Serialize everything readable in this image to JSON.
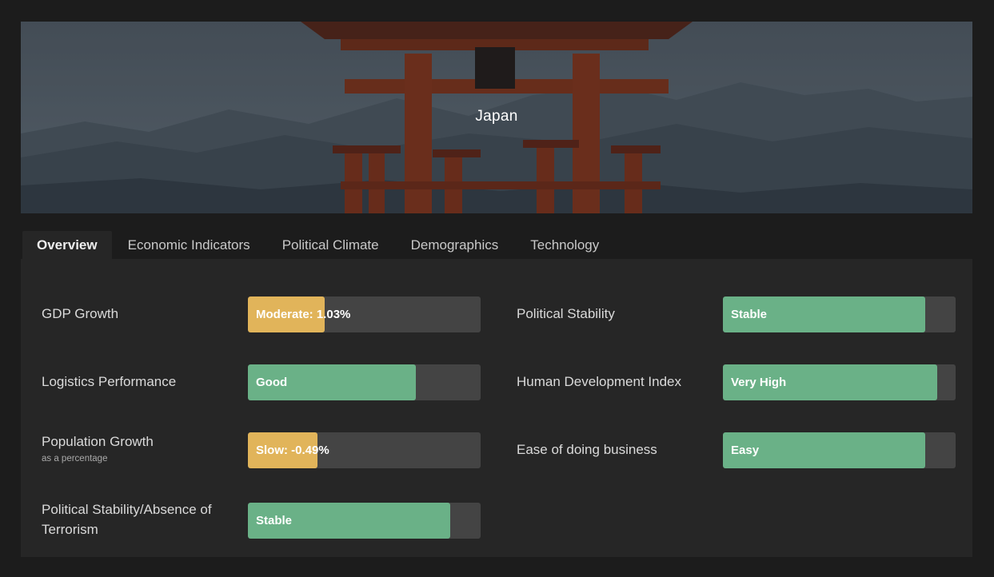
{
  "hero": {
    "title": "Japan",
    "image_description_icon": "torii-gate-image"
  },
  "tabs": [
    {
      "label": "Overview",
      "active": true
    },
    {
      "label": "Economic Indicators",
      "active": false
    },
    {
      "label": "Political Climate",
      "active": false
    },
    {
      "label": "Demographics",
      "active": false
    },
    {
      "label": "Technology",
      "active": false
    }
  ],
  "colors": {
    "moderate": "#e1b45a",
    "good": "#6ab187",
    "track": "#444444"
  },
  "metrics": [
    {
      "label": "GDP Growth",
      "sub": "",
      "value_text": "Moderate: 1.03%",
      "fill": 0.33,
      "color": "#e1b45a"
    },
    {
      "label": "Political Stability",
      "sub": "",
      "value_text": "Stable",
      "fill": 0.87,
      "color": "#6ab187"
    },
    {
      "label": "Logistics Performance",
      "sub": "",
      "value_text": "Good",
      "fill": 0.72,
      "color": "#6ab187"
    },
    {
      "label": "Human Development Index",
      "sub": "",
      "value_text": "Very High",
      "fill": 0.92,
      "color": "#6ab187"
    },
    {
      "label": "Population Growth",
      "sub": "as a percentage",
      "value_text": "Slow: -0.49%",
      "fill": 0.3,
      "color": "#e1b45a"
    },
    {
      "label": "Ease of doing business",
      "sub": "",
      "value_text": "Easy",
      "fill": 0.87,
      "color": "#6ab187"
    },
    {
      "label": "Political Stability/Absence of Terrorism",
      "sub": "",
      "value_text": "Stable",
      "fill": 0.87,
      "color": "#6ab187"
    }
  ]
}
